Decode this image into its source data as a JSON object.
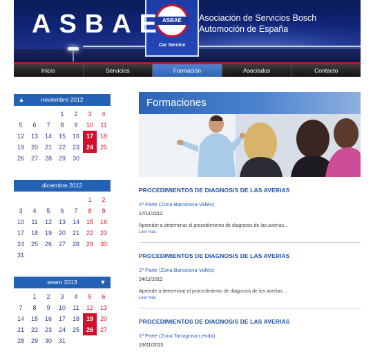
{
  "header": {
    "brand": "ASBAE",
    "subtitle_line1": "Asociación de Servicios Bosch",
    "subtitle_line2": "Automoción de España",
    "sign_text": "ASBAE",
    "sign_caption": "Car Service"
  },
  "nav": {
    "items": [
      "Inicio",
      "Servicios",
      "Formación",
      "Asociados",
      "Contacto"
    ],
    "active": "Formación"
  },
  "calendars": [
    {
      "month": "noviembre 2012",
      "has_prev": true,
      "has_next": false,
      "days": [
        "",
        "",
        "",
        "1",
        "2",
        "3",
        "4",
        "5",
        "6",
        "7",
        "8",
        "9",
        "10",
        "11",
        "12",
        "13",
        "14",
        "15",
        "16",
        "17",
        "18",
        "19",
        "20",
        "21",
        "22",
        "23",
        "24",
        "25",
        "26",
        "27",
        "28",
        "29",
        "30",
        "",
        ""
      ],
      "event_days": [
        "17",
        "24"
      ]
    },
    {
      "month": "diciembre 2012",
      "has_prev": false,
      "has_next": false,
      "days": [
        "",
        "",
        "",
        "",
        "",
        "1",
        "2",
        "3",
        "4",
        "5",
        "6",
        "7",
        "8",
        "9",
        "10",
        "11",
        "12",
        "13",
        "14",
        "15",
        "16",
        "17",
        "18",
        "19",
        "20",
        "21",
        "22",
        "23",
        "24",
        "25",
        "26",
        "27",
        "28",
        "29",
        "30",
        "31",
        "",
        "",
        "",
        "",
        "",
        ""
      ],
      "event_days": []
    },
    {
      "month": "enero 2013",
      "has_prev": false,
      "has_next": true,
      "days": [
        "",
        "1",
        "2",
        "3",
        "4",
        "5",
        "6",
        "7",
        "8",
        "9",
        "10",
        "11",
        "12",
        "13",
        "14",
        "15",
        "16",
        "17",
        "18",
        "19",
        "20",
        "21",
        "22",
        "23",
        "24",
        "25",
        "26",
        "27",
        "28",
        "29",
        "30",
        "31",
        "",
        "",
        ""
      ],
      "event_days": [
        "19",
        "26"
      ]
    }
  ],
  "main": {
    "banner_title": "Formaciones",
    "articles": [
      {
        "title": "PROCEDIMIENTOS DE DIAGNOSIS DE LAS AVERIAS",
        "link": "1ª Parte (Zona Barcelona-Vallés)",
        "date": "17/11/2012",
        "description": "Aprender a determinar el procedimiento de diagnosis de las averías...",
        "more": "Leer más"
      },
      {
        "title": "PROCEDIMIENTOS DE DIAGNOSIS DE LAS AVERIAS",
        "link": "2ª Parte (Zona Barcelona-Vallés)",
        "date": "24/11/2012",
        "description": "Aprende a determinar el procedimiento de diagnosis de las averías...",
        "more": "Leer más"
      },
      {
        "title": "PROCEDIMIENTOS DE DIAGNOSIS DE LAS AVERIAS",
        "link": "1ª Parte (Zona Tarragona-Lérida)",
        "date": "19/01/2013",
        "description": "",
        "more": ""
      }
    ]
  },
  "colors": {
    "accent": "#2361b4",
    "event": "#d2102a",
    "weekend": "#d21f26",
    "link": "#2a5fb8"
  }
}
